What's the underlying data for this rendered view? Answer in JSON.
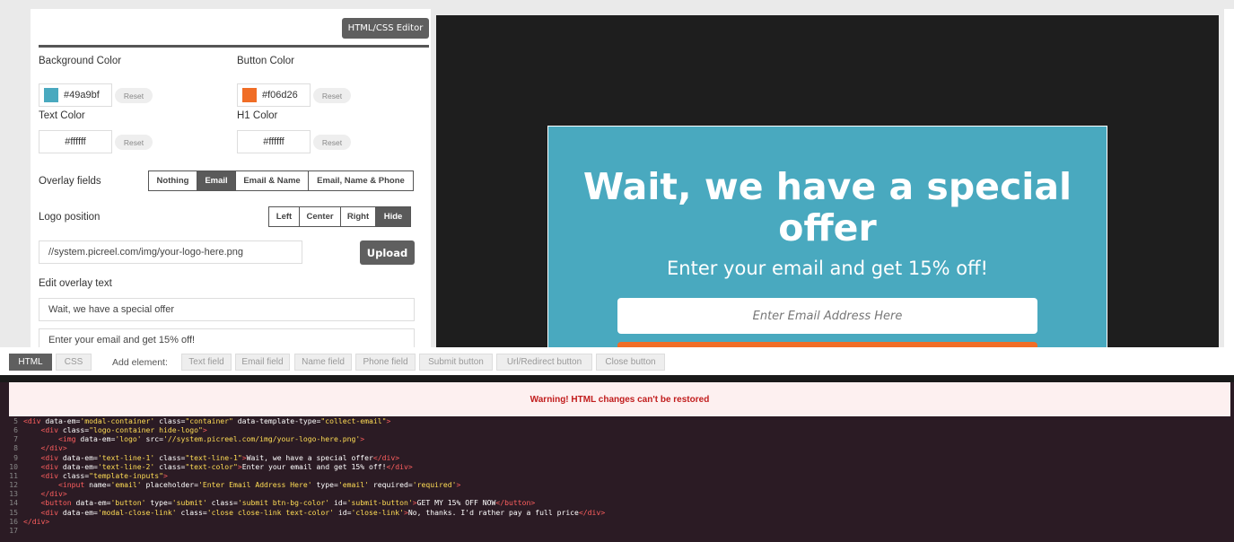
{
  "settings": {
    "editor_button": "HTML/CSS Editor",
    "background_color": {
      "label": "Background Color",
      "value": "#49a9bf",
      "swatch": "#49a9bf"
    },
    "button_color": {
      "label": "Button Color",
      "value": "#f06d26",
      "swatch": "#f06d26"
    },
    "text_color": {
      "label": "Text Color",
      "value": "#ffffff"
    },
    "h1_color": {
      "label": "H1 Color",
      "value": "#ffffff"
    },
    "reset_label": "Reset",
    "overlay_fields": {
      "label": "Overlay fields",
      "options": [
        "Nothing",
        "Email",
        "Email & Name",
        "Email, Name & Phone"
      ],
      "selected": "Email"
    },
    "logo_position": {
      "label": "Logo position",
      "options": [
        "Left",
        "Center",
        "Right",
        "Hide"
      ],
      "selected": "Hide"
    },
    "logo_url": "//system.picreel.com/img/your-logo-here.png",
    "upload_label": "Upload",
    "edit_overlay_text_label": "Edit overlay text",
    "text_line_1": "Wait, we have a special offer",
    "text_line_2": "Enter your email and get 15% off!"
  },
  "preview": {
    "title": "Wait, we have a special offer",
    "subtitle": "Enter your email and get 15% off!",
    "email_placeholder": "Enter Email Address Here",
    "bg_color": "#49a9bf",
    "button_color": "#f06d26"
  },
  "toolbar": {
    "tabs": [
      "HTML",
      "CSS"
    ],
    "active_tab": "HTML",
    "add_element_label": "Add element:",
    "elements": [
      "Text field",
      "Email field",
      "Name field",
      "Phone field",
      "Submit button",
      "Url/Redirect button",
      "Close button"
    ]
  },
  "editor": {
    "warning": "Warning! HTML changes can't be restored",
    "lines": [
      {
        "n": "5",
        "code": "<div data-em='modal-container' class=\"container\" data-template-type=\"collect-email\">"
      },
      {
        "n": "6",
        "code": "    <div class=\"logo-container hide-logo\">"
      },
      {
        "n": "7",
        "code": "        <img data-em='logo' src='//system.picreel.com/img/your-logo-here.png'>"
      },
      {
        "n": "8",
        "code": "    </div>"
      },
      {
        "n": "9",
        "code": "    <div data-em='text-line-1' class=\"text-line-1\">Wait, we have a special offer</div>"
      },
      {
        "n": "10",
        "code": "    <div data-em='text-line-2' class=\"text-color\">Enter your email and get 15% off!</div>"
      },
      {
        "n": "11",
        "code": "    <div class=\"template-inputs\">"
      },
      {
        "n": "12",
        "code": "        <input name='email' placeholder='Enter Email Address Here' type='email' required='required'>"
      },
      {
        "n": "13",
        "code": "    </div>"
      },
      {
        "n": "14",
        "code": "    <button data-em='button' type='submit' class='submit btn-bg-color' id='submit-button'>GET MY 15% OFF NOW</button>"
      },
      {
        "n": "15",
        "code": "    <div data-em='modal-close-link' class='close close-link text-color' id='close-link'>No, thanks. I'd rather pay a full price</div>"
      },
      {
        "n": "16",
        "code": "</div>"
      },
      {
        "n": "17",
        "code": ""
      }
    ]
  }
}
